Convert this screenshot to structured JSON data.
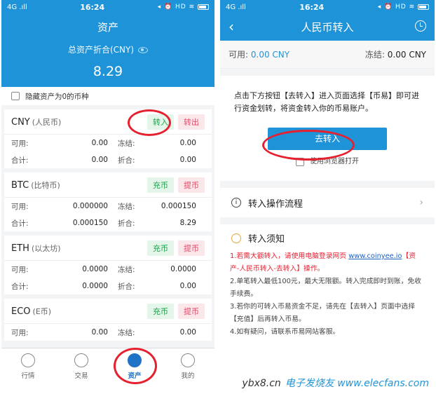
{
  "left": {
    "status": {
      "signal": "4G .ıll",
      "time": "16:24",
      "icons": "◂ ⏰ HD ≋"
    },
    "title": "资产",
    "total_label": "总资产折合(CNY)",
    "total_value": "8.29",
    "hide_zero_label": "隐藏资产为0的币种",
    "labels": {
      "available": "可用:",
      "frozen": "冻结:",
      "total": "合计:",
      "equiv": "折合:"
    },
    "assets": [
      {
        "code": "CNY",
        "name": "(人民币)",
        "btn1": "转入",
        "btn2": "转出",
        "available": "0.00",
        "frozen": "0.00",
        "total": "0.00",
        "equiv": "0.00"
      },
      {
        "code": "BTC",
        "name": "(比特币)",
        "btn1": "充币",
        "btn2": "提币",
        "available": "0.000000",
        "frozen": "0.000150",
        "total": "0.000150",
        "equiv": "8.29"
      },
      {
        "code": "ETH",
        "name": "(以太坊)",
        "btn1": "充币",
        "btn2": "提币",
        "available": "0.0000",
        "frozen": "0.0000",
        "total": "0.0000",
        "equiv": "0.00"
      },
      {
        "code": "ECO",
        "name": "(E币)",
        "btn1": "充币",
        "btn2": "提币",
        "available": "0.00",
        "frozen": "0.00"
      }
    ],
    "tabs": [
      "行情",
      "交易",
      "资产",
      "我的"
    ]
  },
  "right": {
    "status": {
      "signal": "4G .ıll",
      "time": "16:24",
      "icons": "◂ ⏰ HD ≋"
    },
    "title": "人民币转入",
    "available_label": "可用:",
    "available_value": "0.00 CNY",
    "frozen_label": "冻结:",
    "frozen_value": "0.00 CNY",
    "instruction": "点击下方按钮【去转入】进入页面选择【币易】即可进行资金划转，将资金转入你的币易账户。",
    "go_button": "去转入",
    "browser_label": "使用浏览器打开",
    "process_label": "转入操作流程",
    "notice_title": "转入须知",
    "notice1_a": "1.若需大额转入，请使用电脑登录网页 ",
    "notice1_link": "www.coinyee.io",
    "notice1_b": "【资产-人民币转入-去转入】操作。",
    "notice2": "2.单笔转入最低100元，最大无限额。转入完成即时到账，免收手续费。",
    "notice3": "3.若你的可转入币易资金不足，请先在【去转入】页面中选择【充值】后再转入币易。",
    "notice4": "4.如有疑问，请联系币易网站客服。"
  },
  "watermark": {
    "site": "ybx8.cn",
    "brand": "电子发烧友 www.elecfans.com"
  }
}
